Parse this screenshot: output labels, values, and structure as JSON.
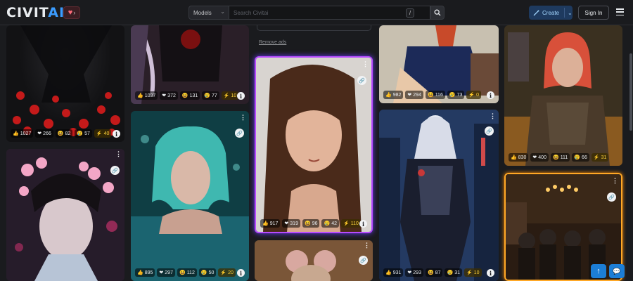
{
  "header": {
    "logo_prefix": "CIVIT",
    "logo_suffix": "AI",
    "search_type": "Models",
    "search_placeholder": "Search Civitai",
    "search_shortcut": "/",
    "create_label": "Create",
    "signin_label": "Sign In"
  },
  "ad": {
    "remove_ads_label": "Remove ads"
  },
  "colors": {
    "accent": "#1c7ed6",
    "brand": "#3b9cff",
    "bolt": "#ffd43b"
  },
  "cards": [
    {
      "id": "c1",
      "likes": "1027",
      "hearts": "266",
      "laughs": "82",
      "cries": "57",
      "buzz": "40"
    },
    {
      "id": "c2",
      "likes": "1037",
      "hearts": "372",
      "laughs": "131",
      "cries": "77",
      "buzz": "10"
    },
    {
      "id": "c3",
      "likes": "917",
      "hearts": "319",
      "laughs": "96",
      "cries": "42",
      "buzz": "110"
    },
    {
      "id": "c4",
      "likes": "982",
      "hearts": "294",
      "laughs": "116",
      "cries": "73",
      "buzz": "0"
    },
    {
      "id": "c5",
      "likes": "830",
      "hearts": "400",
      "laughs": "111",
      "cries": "66",
      "buzz": "31"
    },
    {
      "id": "c7",
      "likes": "895",
      "hearts": "297",
      "laughs": "112",
      "cries": "50",
      "buzz": "20"
    },
    {
      "id": "c9",
      "likes": "931",
      "hearts": "293",
      "laughs": "87",
      "cries": "31",
      "buzz": "10"
    }
  ]
}
